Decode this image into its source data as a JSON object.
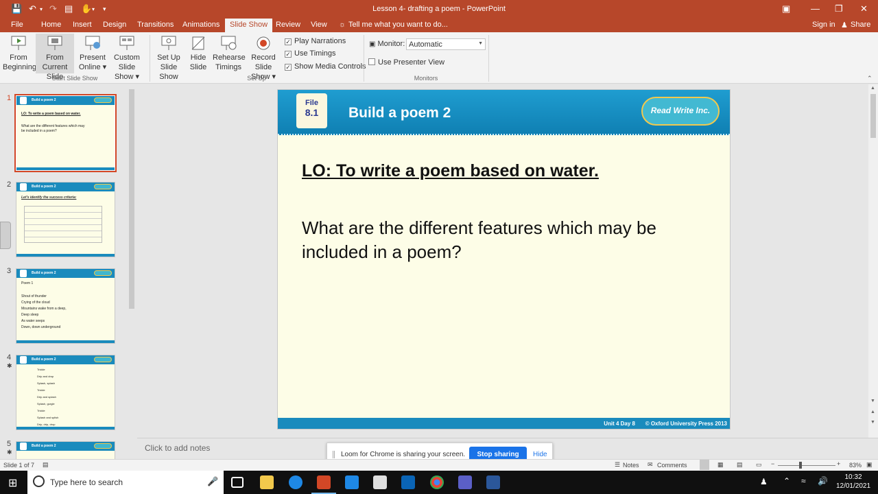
{
  "window": {
    "title": "Lesson 4- drafting a poem  -  PowerPoint"
  },
  "tabs": [
    "File",
    "Home",
    "Insert",
    "Design",
    "Transitions",
    "Animations",
    "Slide Show",
    "Review",
    "View"
  ],
  "active_tab": "Slide Show",
  "tell_me": "Tell me what you want to do...",
  "account": {
    "sign_in": "Sign in",
    "share": "Share"
  },
  "ribbon": {
    "from_beginning": [
      "From",
      "Beginning"
    ],
    "from_current": [
      "From",
      "Current Slide"
    ],
    "present_online": [
      "Present",
      "Online ▾"
    ],
    "custom_show": [
      "Custom Slide",
      "Show ▾"
    ],
    "set_up": [
      "Set Up",
      "Slide Show"
    ],
    "hide_slide": [
      "Hide",
      "Slide"
    ],
    "rehearse": [
      "Rehearse",
      "Timings"
    ],
    "record": [
      "Record Slide",
      "Show ▾"
    ],
    "play_narrations": "Play Narrations",
    "use_timings": "Use Timings",
    "show_media": "Show Media Controls",
    "monitor_label": "Monitor:",
    "monitor_value": "Automatic",
    "presenter_view": "Use Presenter View",
    "groups": {
      "start": "Start Slide Show",
      "setup": "Set Up",
      "monitors": "Monitors"
    }
  },
  "thumbnails": [
    {
      "num": "1",
      "title": "Build a poem 2",
      "lines": [
        "LO: To write a poem based on water.",
        "",
        "What are the different features which may",
        "be included in a poem?"
      ]
    },
    {
      "num": "2",
      "title": "Build a poem 2",
      "lines": [
        "Let's identify the success criteria:"
      ]
    },
    {
      "num": "3",
      "title": "Build a poem 2",
      "lines": [
        "Poem 1",
        "",
        "Shout of thunder",
        "Crying of the cloud",
        "Mountains wake from a deep,",
        "Deep sleep",
        "As water seeps",
        "Down, down underground"
      ]
    },
    {
      "num": "4",
      "title": "Build a poem 2",
      "lines": [
        "Trickle",
        "Drip and drop",
        "Splash, splash",
        "Trickle",
        "Drip and splash",
        "Splash, gurgle",
        "Trickle",
        "Splash and splish",
        "Drip, drip, drop"
      ]
    },
    {
      "num": "5",
      "title": "Build a poem 2",
      "lines": []
    }
  ],
  "slide": {
    "badge_top": "File",
    "badge_num": "8.1",
    "title": "Build a poem 2",
    "logo": "Read Write Inc.",
    "lo": "LO: To write a poem based on water.",
    "question": "What are the different features which may be included in a poem?",
    "footer_unit": "Unit 4    Day 8",
    "footer_copy": "© Oxford University Press 2013"
  },
  "notes_placeholder": "Click to add notes",
  "loom": {
    "message": "Loom for Chrome is sharing your screen.",
    "stop": "Stop sharing",
    "hide": "Hide"
  },
  "status": {
    "slide_of": "Slide 1 of 7",
    "notes": "Notes",
    "comments": "Comments",
    "zoom": "83%"
  },
  "taskbar": {
    "search_placeholder": "Type here to search",
    "time": "10:32",
    "date": "12/01/2021"
  },
  "colors": {
    "ppt_accent": "#b7472a",
    "slide_header": "#1a8bbd",
    "slide_bg": "#fdfde7",
    "loom_button": "#1a73e8"
  }
}
